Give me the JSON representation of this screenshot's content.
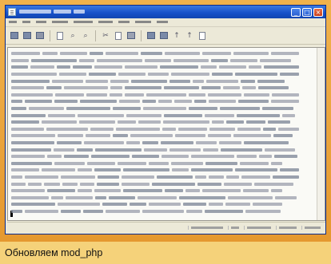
{
  "caption": {
    "text": "Обновляем mod_php"
  },
  "window": {
    "title_glyphs": [
      "min-icon",
      "max-icon",
      "close-icon"
    ],
    "controls": {
      "minimize": "_",
      "maximize": "□",
      "close": "×"
    }
  },
  "toolbar": {
    "icons": [
      "new-doc-icon",
      "open-icon",
      "save-icon",
      "print-icon",
      "find-icon",
      "replace-icon",
      "cut-icon",
      "copy-icon",
      "paste-icon",
      "undo-icon",
      "redo-icon",
      "format-icon",
      "options-icon"
    ]
  },
  "colors": {
    "frame": "#e8a23a",
    "caption_bg": "#f5d27a",
    "titlebar": "#1650c8",
    "editor_bg": "#fafaf6"
  }
}
